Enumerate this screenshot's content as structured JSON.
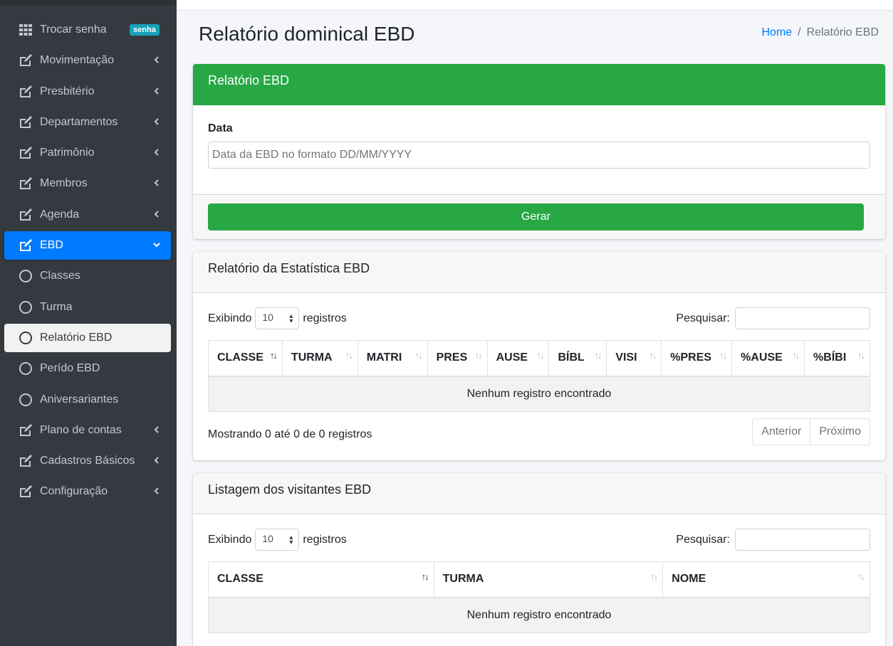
{
  "sidebar": {
    "items": [
      {
        "label": "Trocar senha",
        "icon": "grid-icon",
        "badge": "senha"
      },
      {
        "label": "Movimentação",
        "icon": "edit-icon"
      },
      {
        "label": "Presbitério",
        "icon": "edit-icon"
      },
      {
        "label": "Departamentos",
        "icon": "edit-icon"
      },
      {
        "label": "Patrimônio",
        "icon": "edit-icon"
      },
      {
        "label": "Membros",
        "icon": "edit-icon"
      },
      {
        "label": "Agenda",
        "icon": "edit-icon"
      },
      {
        "label": "EBD",
        "icon": "edit-icon"
      },
      {
        "label": "Classes",
        "icon": "circle-icon"
      },
      {
        "label": "Turma",
        "icon": "circle-icon"
      },
      {
        "label": "Relatório EBD",
        "icon": "circle-icon"
      },
      {
        "label": "Perído EBD",
        "icon": "circle-icon"
      },
      {
        "label": "Aniversariantes",
        "icon": "circle-icon"
      },
      {
        "label": "Plano de contas",
        "icon": "edit-icon"
      },
      {
        "label": "Cadastros Básicos",
        "icon": "edit-icon"
      },
      {
        "label": "Configuração",
        "icon": "edit-icon"
      }
    ]
  },
  "header": {
    "title": "Relatório dominical EBD",
    "breadcrumb": {
      "home": "Home",
      "separator": "/",
      "current": "Relatório EBD"
    }
  },
  "report_card": {
    "title": "Relatório EBD",
    "date_label": "Data",
    "date_placeholder": "Data da EBD no formato DD/MM/YYYY",
    "submit_label": "Gerar"
  },
  "stats_card": {
    "title": "Relatório da Estatística EBD",
    "length_prefix": "Exibindo",
    "length_value": "10",
    "length_suffix": "registros",
    "search_label": "Pesquisar:",
    "columns": [
      "CLASSE",
      "TURMA",
      "MATRI",
      "PRES",
      "AUSE",
      "BÍBL",
      "VISI",
      "%PRES",
      "%AUSE",
      "%BÍBI"
    ],
    "empty_text": "Nenhum registro encontrado",
    "info": "Mostrando 0 até 0 de 0 registros",
    "prev": "Anterior",
    "next": "Próximo"
  },
  "visitors_card": {
    "title": "Listagem dos visitantes EBD",
    "length_prefix": "Exibindo",
    "length_value": "10",
    "length_suffix": "registros",
    "search_label": "Pesquisar:",
    "columns": [
      "CLASSE",
      "TURMA",
      "NOME"
    ],
    "empty_text": "Nenhum registro encontrado"
  },
  "colors": {
    "sidebar_bg": "#343a40",
    "active_blue": "#007bff",
    "success_green": "#28a745",
    "badge_teal": "#17a2b8"
  }
}
